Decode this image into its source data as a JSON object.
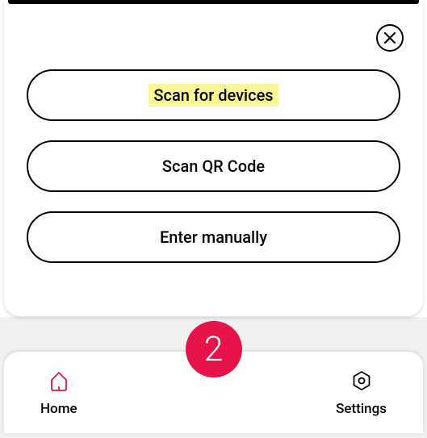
{
  "modal": {
    "options": [
      {
        "label": "Scan for devices",
        "highlighted": true
      },
      {
        "label": "Scan QR Code",
        "highlighted": false
      },
      {
        "label": "Enter manually",
        "highlighted": false
      }
    ]
  },
  "nav": {
    "home_label": "Home",
    "settings_label": "Settings",
    "badge_value": "2"
  },
  "colors": {
    "accent": "#e6134b",
    "highlight": "#f9f896"
  }
}
